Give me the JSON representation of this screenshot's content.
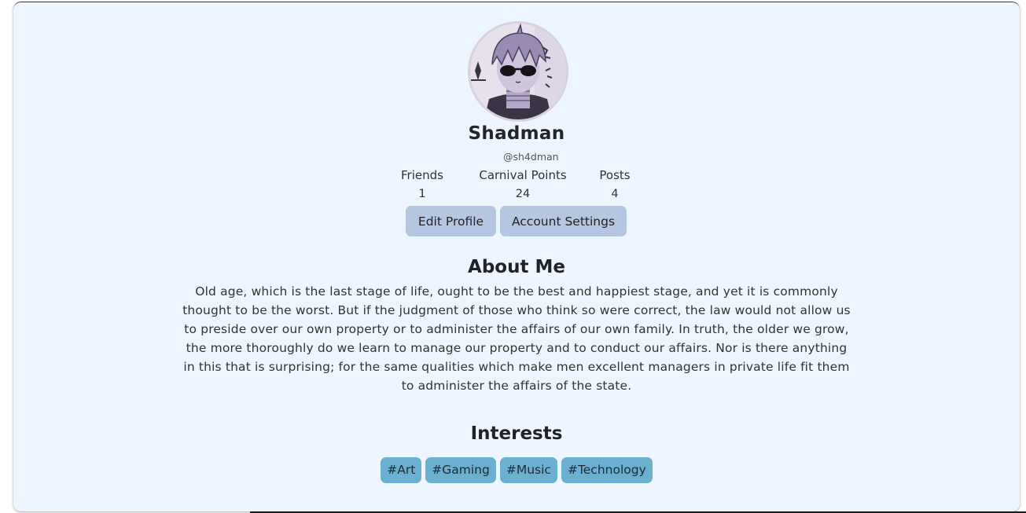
{
  "profile": {
    "display_name": "Shadman",
    "handle": "@sh4dman",
    "stats": {
      "friends_label": "Friends",
      "friends_value": "1",
      "points_label": "Carnival Points",
      "points_value": "24",
      "posts_label": "Posts",
      "posts_value": "4"
    }
  },
  "actions": {
    "edit_profile": "Edit Profile",
    "account_settings": "Account Settings"
  },
  "about": {
    "title": "About Me",
    "text": "Old age, which is the last stage of life, ought to be the best and happiest stage, and yet it is commonly thought to be the worst. But if the judgment of those who think so were correct, the law would not allow us to preside over our own property or to administer the affairs of our own family. In truth, the older we grow, the more thoroughly do we learn to manage our property and to conduct our affairs. Nor is there anything in this that is surprising; for the same qualities which make men excellent managers in private life fit them to administer the affairs of the state."
  },
  "interests": {
    "title": "Interests",
    "tags": [
      "#Art",
      "#Gaming",
      "#Music",
      "#Technology"
    ]
  },
  "colors": {
    "card_background": "#edf5fe",
    "button_background": "#b5c6e0",
    "tag_background": "#6bb0cf"
  }
}
